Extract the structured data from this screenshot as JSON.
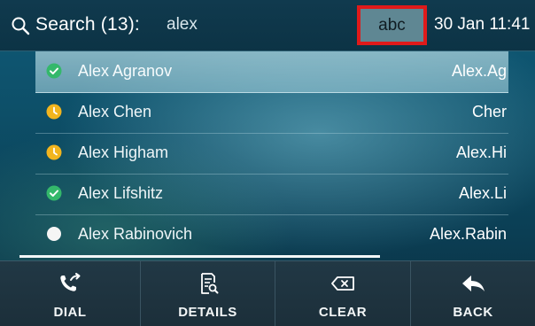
{
  "header": {
    "search_label": "Search (13):",
    "search_value": "alex",
    "input_mode": "abc",
    "datetime": "30 Jan 11:41"
  },
  "contacts": [
    {
      "name": "Alex Agranov",
      "id": "Alex.Ag",
      "status": "available",
      "selected": true
    },
    {
      "name": "Alex Chen",
      "id": "Cher",
      "status": "away",
      "selected": false
    },
    {
      "name": "Alex Higham",
      "id": "Alex.Hi",
      "status": "away",
      "selected": false
    },
    {
      "name": "Alex Lifshitz",
      "id": "Alex.Li",
      "status": "available",
      "selected": false
    },
    {
      "name": "Alex Rabinovich",
      "id": "Alex.Rabin",
      "status": "offline",
      "selected": false
    }
  ],
  "softkeys": [
    {
      "label": "DIAL",
      "icon": "phone-transfer-icon"
    },
    {
      "label": "DETAILS",
      "icon": "document-search-icon"
    },
    {
      "label": "CLEAR",
      "icon": "backspace-icon"
    },
    {
      "label": "BACK",
      "icon": "back-arrow-icon"
    }
  ],
  "colors": {
    "available": "#34b86b",
    "away": "#f2b51e",
    "offline": "#f5f5f5",
    "highlight_border": "#e01a1a"
  }
}
